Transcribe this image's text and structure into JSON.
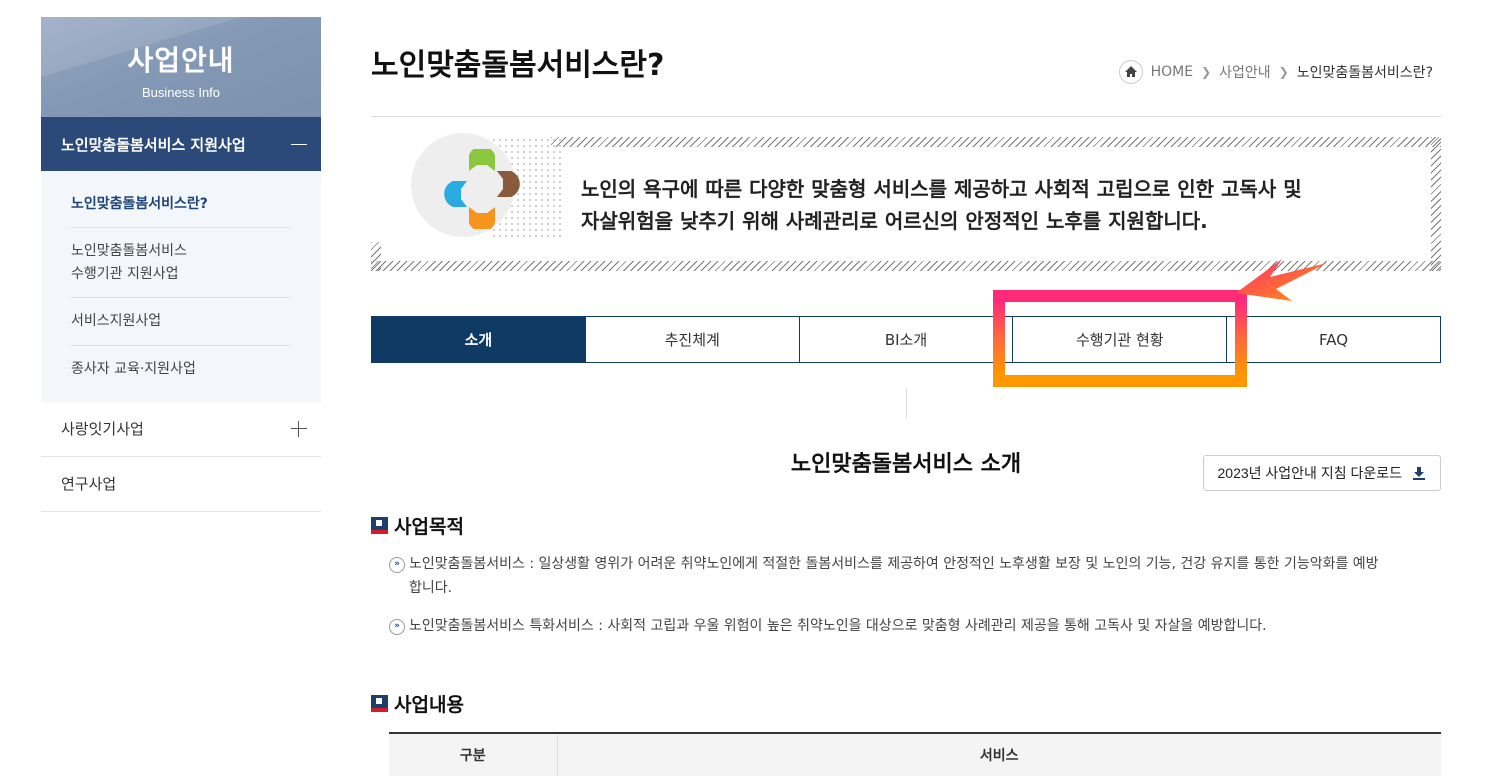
{
  "sidebar": {
    "title": "사업안내",
    "subtitle": "Business Info",
    "active_section": "노인맞춤돌봄서비스 지원사업",
    "submenu": [
      "노인맞춤돌봄서비스란?",
      "노인맞춤돌봄서비스\n수행기관 지원사업",
      "서비스지원사업",
      "종사자 교육·지원사업"
    ],
    "items": [
      "사랑잇기사업",
      "연구사업"
    ]
  },
  "page": {
    "title": "노인맞춤돌봄서비스란?",
    "breadcrumb": [
      "HOME",
      "사업안내",
      "노인맞춤돌봄서비스란?"
    ]
  },
  "banner": {
    "line1": "노인의 욕구에 따른 다양한 맞춤형 서비스를 제공하고 사회적 고립으로 인한 고독사 및",
    "line2": "자살위험을 낮추기 위해 사례관리로 어르신의 안정적인 노후를 지원합니다."
  },
  "tabs": [
    {
      "label": "소개",
      "active": true
    },
    {
      "label": "추진체계",
      "active": false
    },
    {
      "label": "BI소개",
      "active": false
    },
    {
      "label": "수행기관 현황",
      "active": false
    },
    {
      "label": "FAQ",
      "active": false
    }
  ],
  "section": {
    "title": "노인맞춤돌봄서비스 소개",
    "download_label": "2023년 사업안내 지침 다운로드"
  },
  "purpose": {
    "heading": "사업목적",
    "bullets": [
      "노인맞춤돌봄서비스 : 일상생활 영위가 어려운 취약노인에게 적절한 돌봄서비스를 제공하여 안정적인 노후생활 보장 및 노인의 기능, 건강 유지를 통한 기능악화를 예방합니다.",
      "노인맞춤돌봄서비스 특화서비스 : 사회적 고립과 우울 위험이 높은 취약노인을 대상으로 맞춤형 사례관리 제공을 통해 고독사 및 자살을 예방합니다."
    ]
  },
  "content": {
    "heading": "사업내용",
    "table_headers": [
      "구분",
      "서비스"
    ]
  },
  "colors": {
    "navy": "#0f3a63",
    "sidebar_active": "#2b4a7a",
    "highlight_pink": "#ff2a7a",
    "highlight_orange": "#ff9800"
  },
  "icons": {
    "home": "home-icon",
    "download": "download-icon",
    "bullet": "double-chevron-icon",
    "plus": "plus-icon",
    "minus": "minus-icon"
  }
}
